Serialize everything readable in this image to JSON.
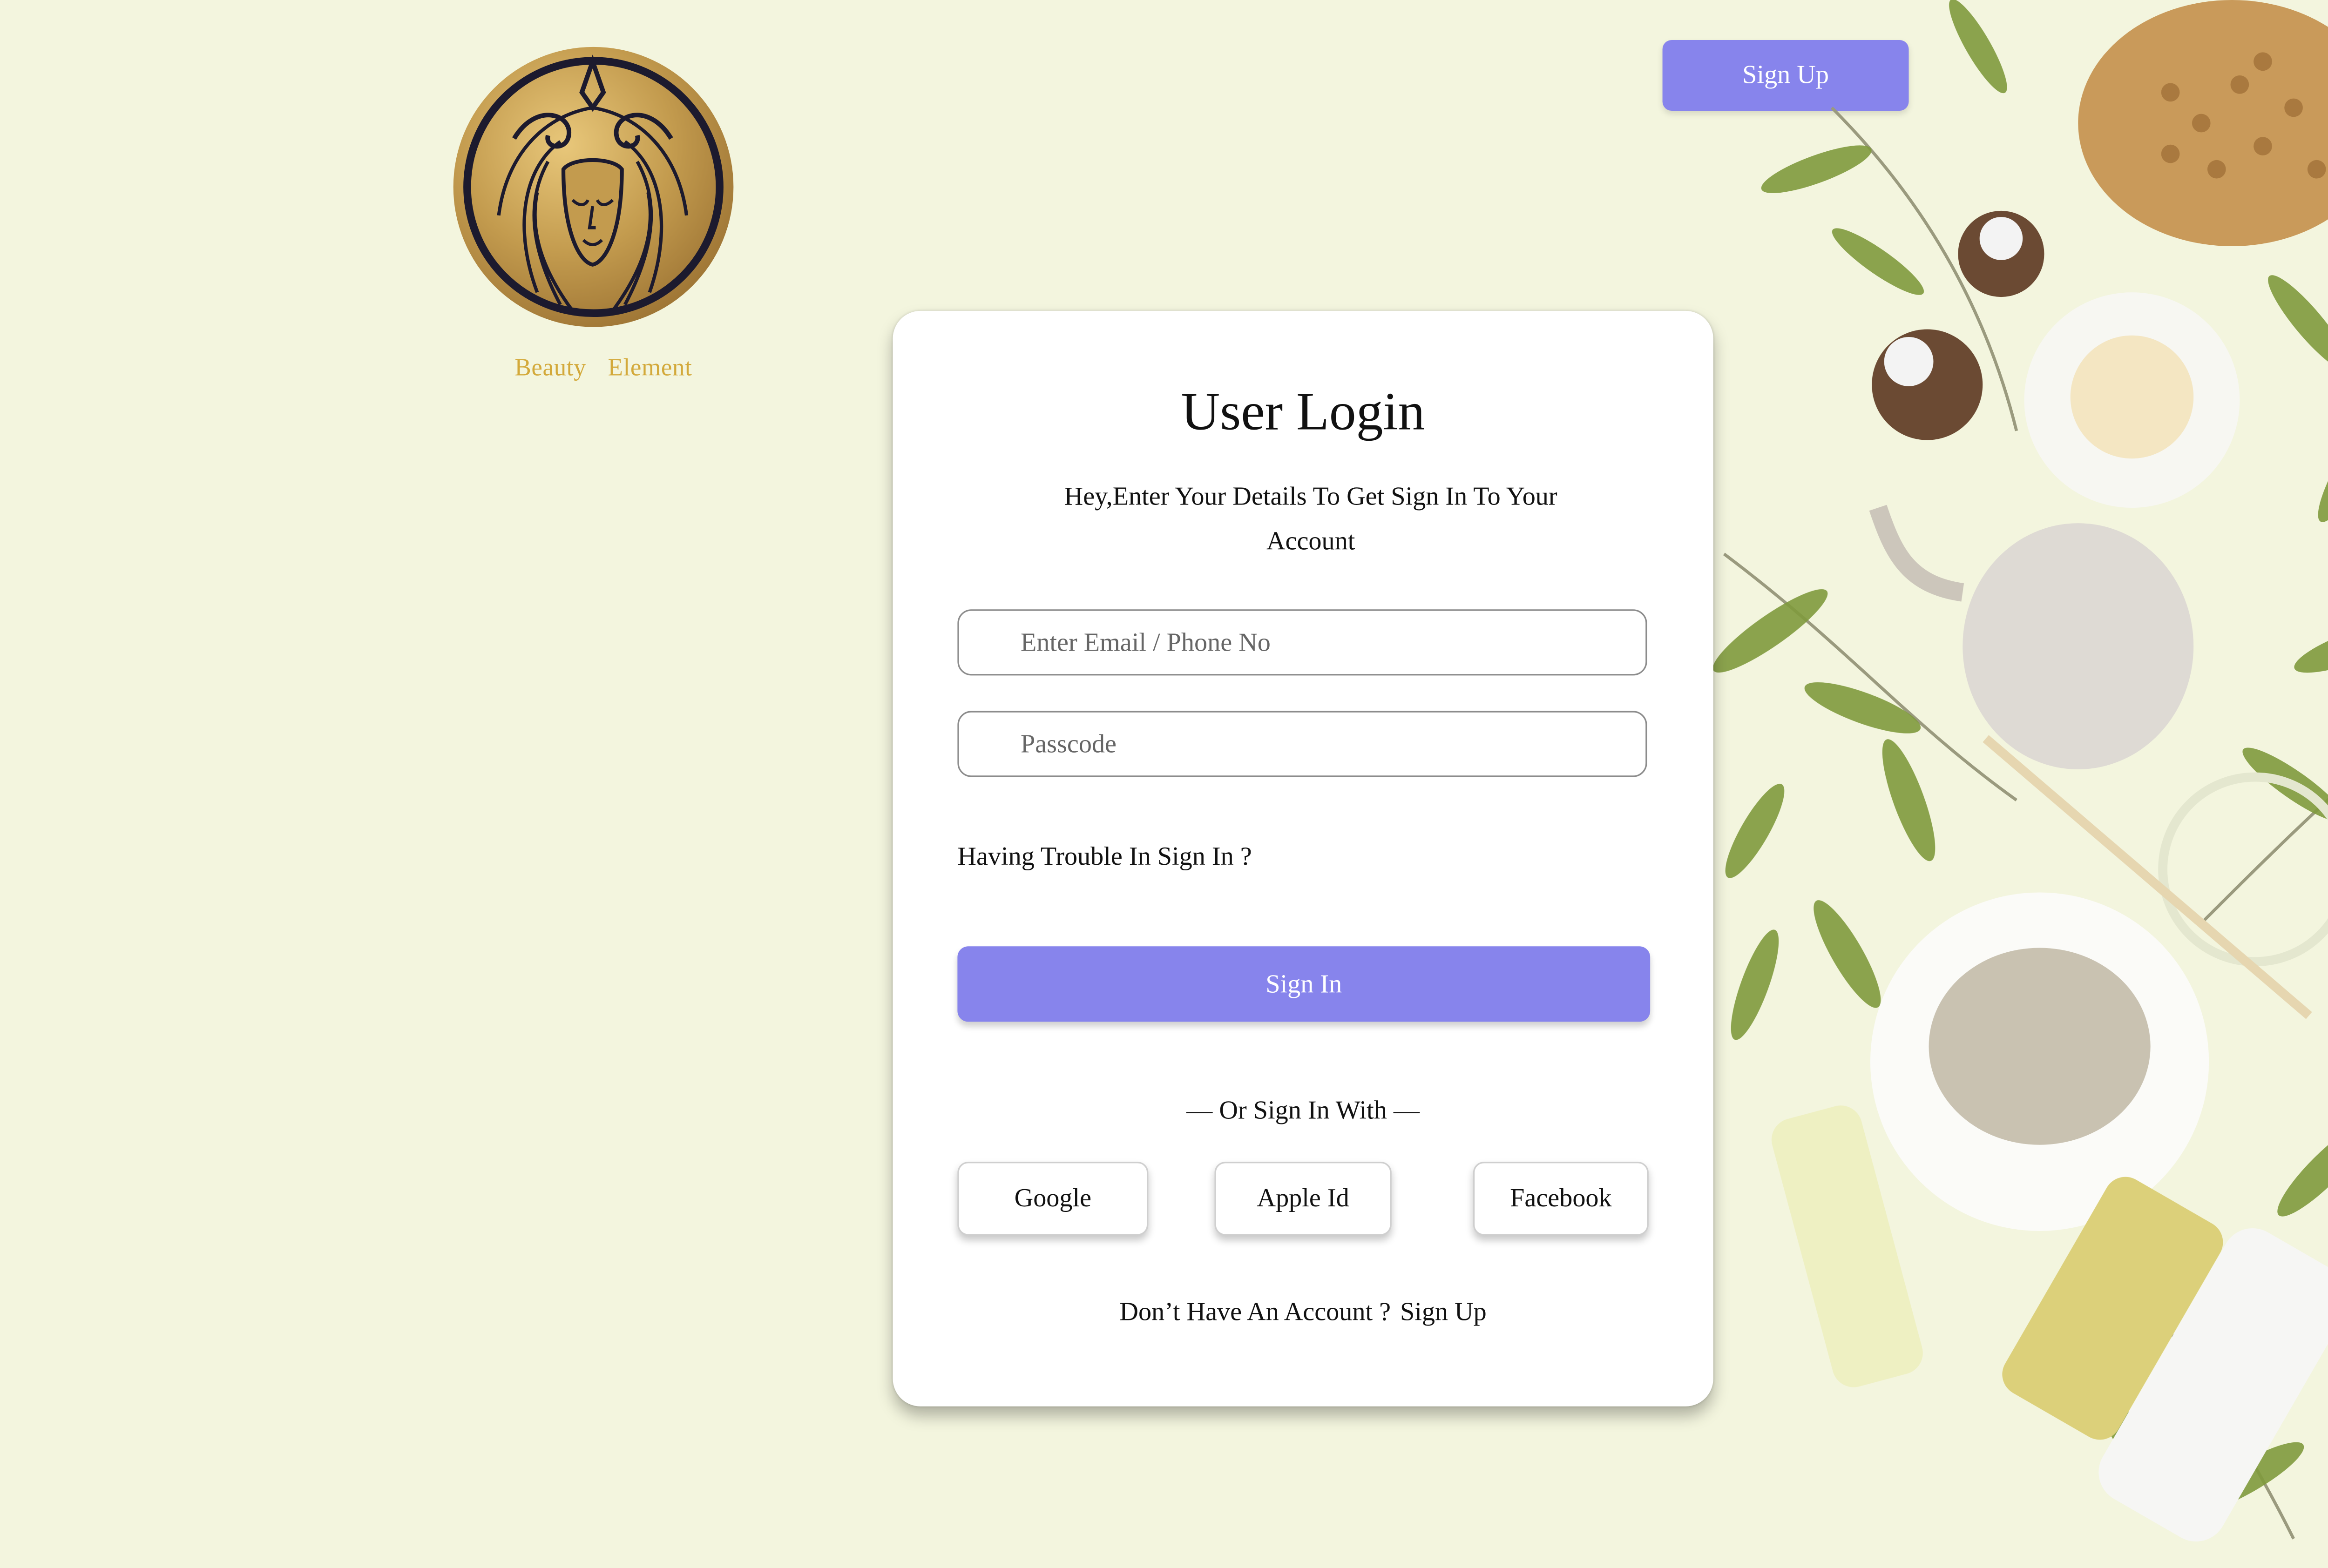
{
  "brand": {
    "word1": "Beauty",
    "word2": "Element",
    "logo_icon": "goddess-face-logo-icon",
    "accent_color": "#d3a93a"
  },
  "header": {
    "signup_label": "Sign Up"
  },
  "login": {
    "title": "User Login",
    "subtitle": "Hey,Enter Your Details To Get Sign In To Your Account",
    "email_placeholder": "Enter Email / Phone No",
    "password_placeholder": "Passcode",
    "trouble_link": "Having Trouble In Sign In ?",
    "signin_label": "Sign In",
    "divider_text": "— Or Sign In With —",
    "social": {
      "google": "Google",
      "apple": "Apple Id",
      "facebook": "Facebook"
    },
    "no_account_text": "Don’t Have An Account ?",
    "signup_link": "Sign Up"
  },
  "colors": {
    "background": "#f3f5de",
    "primary_button": "#8784ec",
    "card": "#ffffff"
  },
  "decoration": {
    "icon": "spa-products-illustration-icon"
  }
}
